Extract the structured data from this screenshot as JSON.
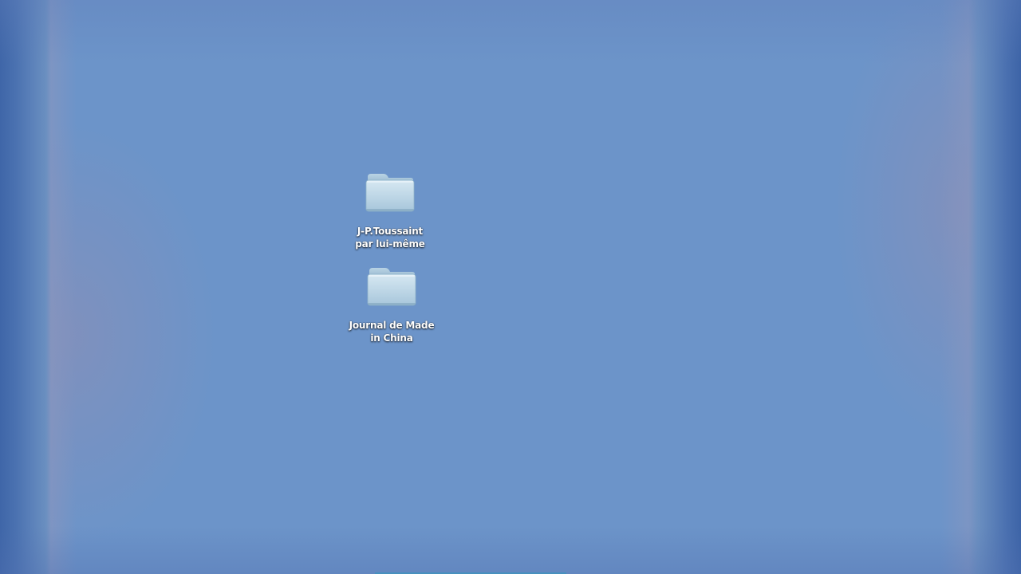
{
  "desktop": {
    "icons": [
      {
        "label": "J-P.Toussaint\npar lui-même",
        "icon": "folder-icon"
      },
      {
        "label": "Journal de Made\nin China",
        "icon": "folder-icon"
      }
    ]
  },
  "colors": {
    "wallpaper": "#6c94c9",
    "wallpaper_edge": "#3f66a8",
    "folder_body": "#bcd6e6",
    "folder_tab": "#a9c8dc",
    "label_text": "#ffffff"
  }
}
